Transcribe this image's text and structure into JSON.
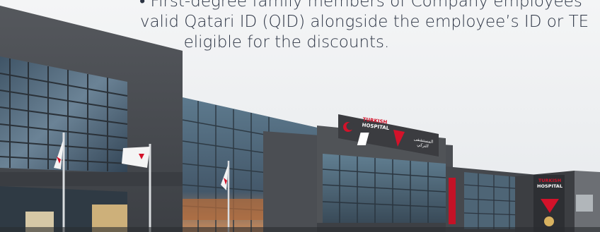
{
  "hero": {
    "caption_lines": [
      "• First-degree family members of Company employees",
      "valid Qatari ID (QID) alongside the employee’s ID or TE",
      "eligible for the discounts."
    ],
    "signs": {
      "main_en_1": "TURKISH",
      "main_en_2": "HOSPITAL",
      "main_ar": "المستشفى التركي",
      "side_en_1": "TURKISH",
      "side_en_2": "HOSPITAL"
    },
    "colors": {
      "sky": "#eef0f1",
      "facade": "#4a4d52",
      "glass": "#5a6f80",
      "brand_red": "#d3122a"
    }
  }
}
